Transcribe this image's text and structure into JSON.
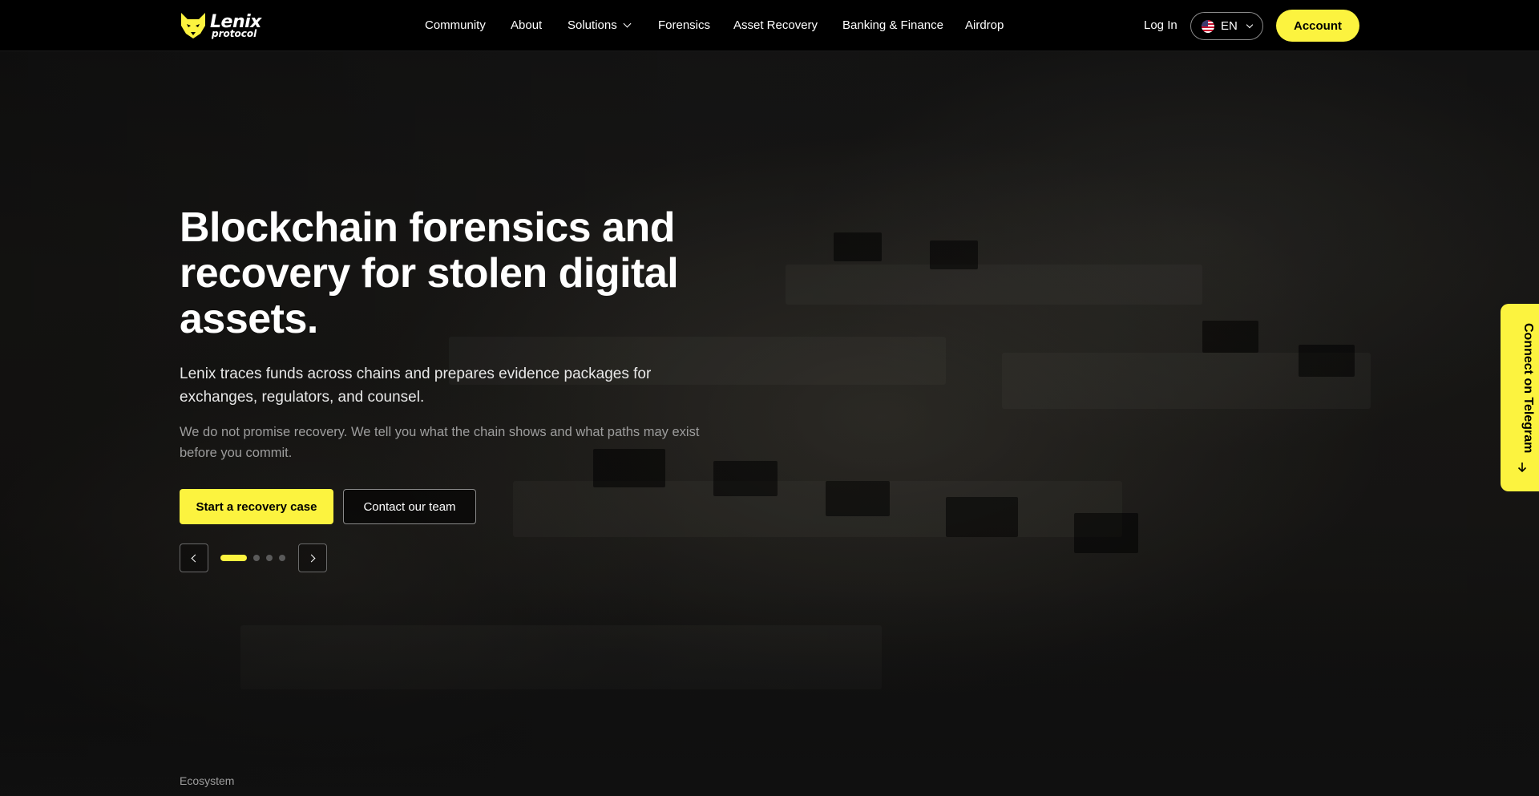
{
  "brand": {
    "name": "Lenix",
    "sub": "protocol",
    "accent_color": "#fcf33f"
  },
  "nav": {
    "items": [
      {
        "label": "Community",
        "has_dropdown": false
      },
      {
        "label": "About",
        "has_dropdown": false
      },
      {
        "label": "Solutions",
        "has_dropdown": true
      },
      {
        "label": "Forensics",
        "has_dropdown": false
      },
      {
        "label": "Asset Recovery",
        "has_dropdown": false
      },
      {
        "label": "Banking & Finance",
        "has_dropdown": false
      },
      {
        "label": "Airdrop",
        "has_dropdown": false
      }
    ],
    "login_label": "Log In",
    "language": {
      "code": "EN",
      "flag_icon": "us-flag-icon"
    },
    "account_label": "Account"
  },
  "hero": {
    "title": "Blockchain forensics and recovery for stolen digital assets.",
    "subtitle": "Lenix traces funds across chains and prepares evidence packages for exchanges, regulators, and counsel.",
    "note": "We do not promise recovery. We tell you what the chain shows and what paths may exist before you commit.",
    "primary_cta": "Start a recovery case",
    "secondary_cta": "Contact our team",
    "carousel": {
      "slide_count": 4,
      "active_index": 0
    }
  },
  "section_label": "Ecosystem",
  "side_tab": {
    "label": "Connect on Telegram",
    "icon": "arrow-down-icon"
  }
}
